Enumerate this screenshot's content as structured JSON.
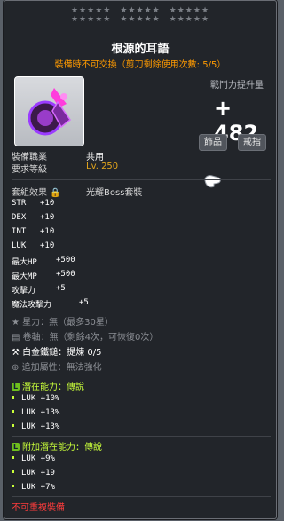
{
  "tooltip": {
    "title": "根源的耳語",
    "trade_notice": "裝備時不可交換（剪刀剩餘使用次數: 5/5）",
    "combat_power_label": "戰鬥力提升量",
    "combat_power_value": "+ 482",
    "buttons": {
      "accessory": "飾品",
      "ring": "戒指"
    },
    "basic": {
      "job_label": "裝備職業",
      "job_value": "共用",
      "level_label": "要求等級",
      "level_value": "Lv. 250"
    },
    "set_effect": {
      "label": "套組效果",
      "value": "光耀Boss套裝"
    },
    "stats": [
      {
        "name": "STR",
        "value": "+10"
      },
      {
        "name": "DEX",
        "value": "+10"
      },
      {
        "name": "INT",
        "value": "+10"
      },
      {
        "name": "LUK",
        "value": "+10"
      },
      {
        "name": "最大HP",
        "value": "+500"
      },
      {
        "name": "最大MP",
        "value": "+500"
      },
      {
        "name": "攻擊力",
        "value": "+5"
      },
      {
        "name": "魔法攻擊力",
        "value": "+5"
      }
    ],
    "star_force": {
      "label": "星力",
      "value": "：無（最多30星）"
    },
    "scroll": {
      "label": "卷軸",
      "value": "：無（剩餘4次，可恢復0次）"
    },
    "hammer": {
      "label": "白金鐵鎚",
      "value": "：提煉 0/5"
    },
    "bonus_stat": {
      "label": "追加屬性",
      "value": "：無法強化"
    },
    "potential": {
      "label": "潛在能力",
      "grade": "：傳說",
      "lines": [
        "LUK +10%",
        "LUK +13%",
        "LUK +13%"
      ]
    },
    "additional_potential": {
      "label": "附加潛在能力",
      "grade": "：傳說",
      "lines": [
        "LUK +9%",
        "LUK +19",
        "LUK +7%"
      ]
    },
    "footer": "不可重複裝備"
  },
  "colors": {
    "orange": "#ff9a00",
    "gold": "#e3a51c",
    "legendary_green": "#c9ff3a",
    "red": "#ff3c3c"
  }
}
